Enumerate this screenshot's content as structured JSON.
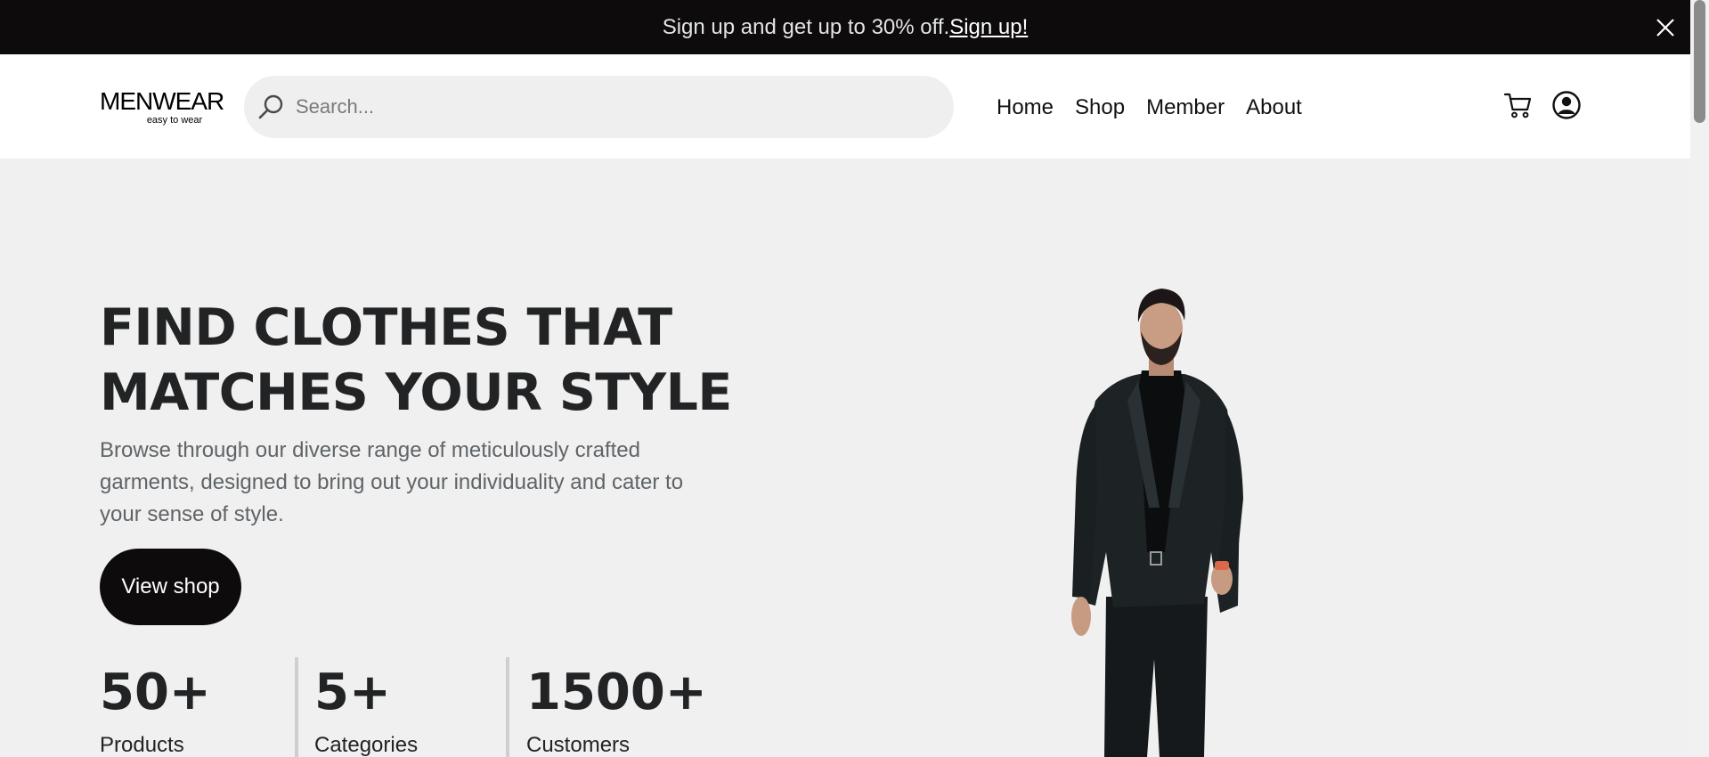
{
  "promo": {
    "text": "Sign up and get up to 30% off.",
    "link": "Sign up!"
  },
  "nav": {
    "logo": {
      "main": "MENWEAR",
      "tag": "easy to wear"
    },
    "search_placeholder": "Search...",
    "menu": [
      "Home",
      "Shop",
      "Member",
      "About"
    ],
    "icons": [
      "cart-icon",
      "user-icon"
    ]
  },
  "hero": {
    "title_line1": "FIND CLOTHES THAT",
    "title_line2": "MATCHES YOUR STYLE",
    "description": "Browse through our diverse range of meticulously crafted garments, designed to bring out your individuality and cater to your sense of style.",
    "cta": "View shop",
    "stats": [
      {
        "value": "50+",
        "label": "Products"
      },
      {
        "value": "5+",
        "label": "Categories"
      },
      {
        "value": "1500+",
        "label": "Customers"
      }
    ]
  },
  "colors": {
    "promo_bg": "#0d0b0b",
    "hero_bg": "#f0f0f0",
    "title": "#222325",
    "muted": "#5f6468"
  }
}
